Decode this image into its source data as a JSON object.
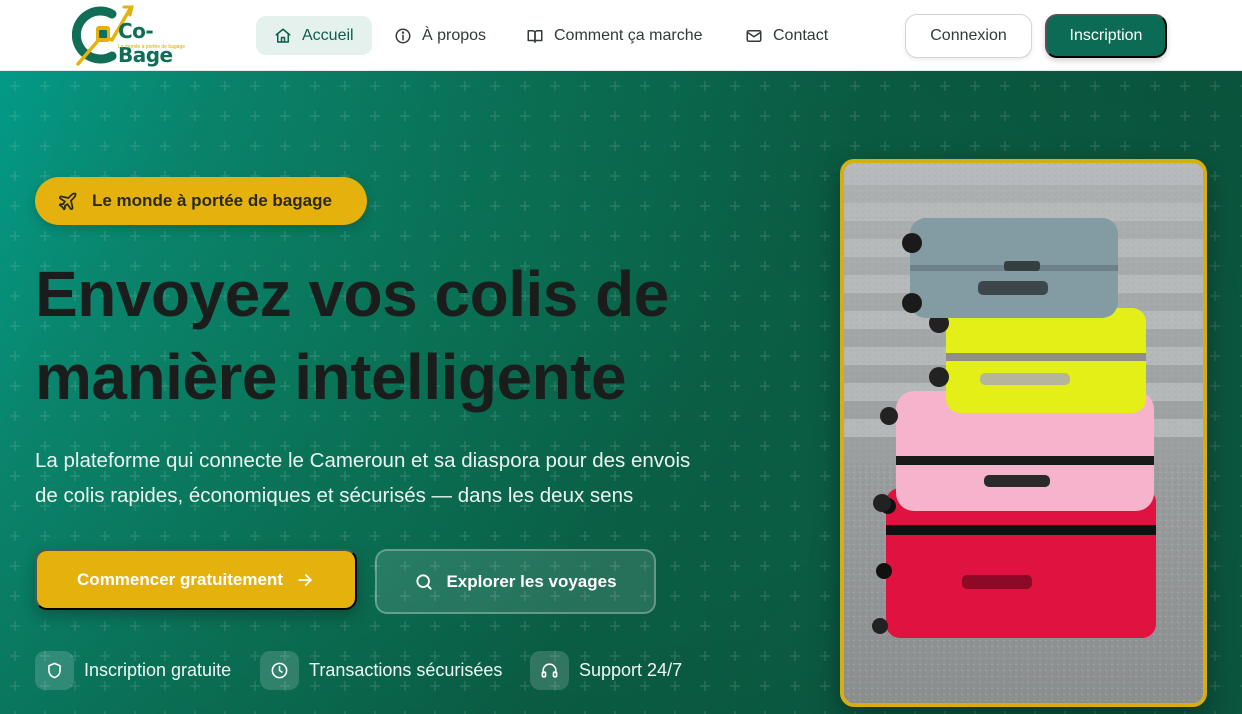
{
  "brand": {
    "name": "Co-Bage",
    "tagline": "Le monde à portée de bagage",
    "colors": {
      "primary": "#0b6b54",
      "accent": "#e5b10d",
      "text_dark": "#1b1d1c"
    }
  },
  "nav": {
    "items": [
      {
        "label": "Accueil",
        "icon": "home-icon",
        "active": true
      },
      {
        "label": "À propos",
        "icon": "info-icon",
        "active": false
      },
      {
        "label": "Comment ça marche",
        "icon": "book-icon",
        "active": false
      },
      {
        "label": "Contact",
        "icon": "mail-icon",
        "active": false
      }
    ],
    "login_label": "Connexion",
    "signup_label": "Inscription"
  },
  "hero": {
    "badge_label": "Le monde à portée de bagage",
    "badge_icon": "plane-icon",
    "headline_line1": "Envoyez vos colis de",
    "headline_line2": "manière intelligente",
    "subtitle_line1": "La plateforme qui connecte le Cameroun et sa diaspora pour des envois",
    "subtitle_line2": "de colis rapides, économiques et sécurisés — dans les deux sens",
    "primary_cta": {
      "label": "Commencer gratuitement",
      "icon": "arrow-right-icon"
    },
    "secondary_cta": {
      "label": "Explorer les voyages",
      "icon": "search-icon"
    },
    "features": [
      {
        "label": "Inscription gratuite",
        "icon": "shield-icon"
      },
      {
        "label": "Transactions sécurisées",
        "icon": "clock-icon"
      },
      {
        "label": "Support 24/7",
        "icon": "headphones-icon"
      }
    ],
    "image": {
      "subject": "stack of colorful suitcases",
      "icon": "luggage-photo"
    }
  }
}
